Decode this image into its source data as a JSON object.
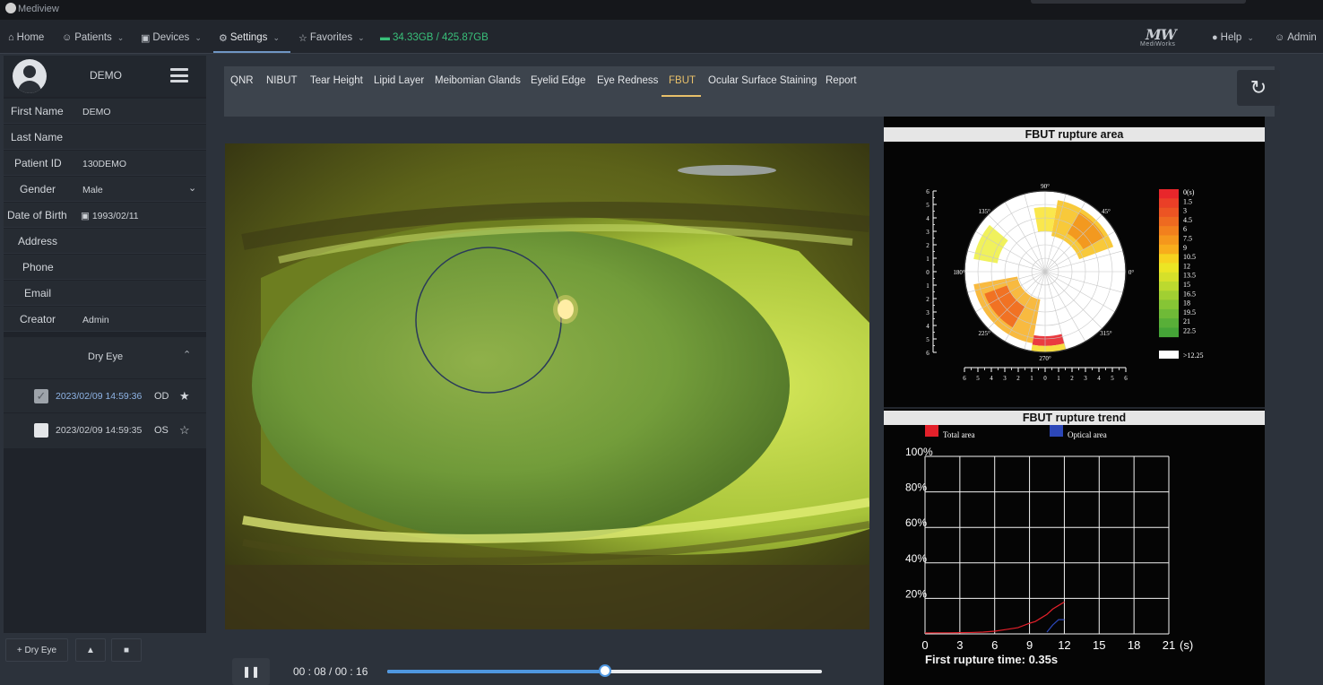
{
  "window": {
    "title": "Mediview"
  },
  "topnav": {
    "home": "Home",
    "patients": "Patients",
    "devices": "Devices",
    "settings": "Settings",
    "favorites": "Favorites",
    "storage": "34.33GB / 425.87GB",
    "brand_mark": "MW",
    "brand_name": "MediWorks",
    "help": "Help",
    "user": "Admin"
  },
  "profile": {
    "name": "DEMO"
  },
  "fields": [
    {
      "label": "First Name",
      "value": "DEMO"
    },
    {
      "label": "Last Name",
      "value": ""
    },
    {
      "label": "Patient ID",
      "value": "130DEMO"
    },
    {
      "label": "Gender",
      "value": "Male"
    },
    {
      "label": "Date of Birth",
      "value": "1993/02/11"
    },
    {
      "label": "Address",
      "value": ""
    },
    {
      "label": "Phone",
      "value": ""
    },
    {
      "label": "Email",
      "value": ""
    },
    {
      "label": "Creator",
      "value": "Admin"
    }
  ],
  "exam_group": {
    "title": "Dry Eye",
    "exams": [
      {
        "timestamp": "2023/02/09 14:59:36",
        "eye": "OD",
        "checked": true,
        "starred": true
      },
      {
        "timestamp": "2023/02/09 14:59:35",
        "eye": "OS",
        "checked": false,
        "starred": false
      }
    ]
  },
  "sidebar_buttons": {
    "add": "+ Dry Eye"
  },
  "tabs": [
    "QNR",
    "NIBUT",
    "Tear Height",
    "Lipid Layer",
    "Meibomian Glands",
    "Eyelid Edge",
    "Eye Redness",
    "FBUT",
    "Ocular Surface Staining",
    "Report"
  ],
  "active_tab": "FBUT",
  "player": {
    "time": "00 : 08 / 00 : 16",
    "progress": 0.5
  },
  "area_chart": {
    "title": "FBUT rupture area",
    "angle_labels": [
      "90°",
      "45°",
      "0°",
      "315°",
      "270°",
      "225°",
      "180°",
      "135°"
    ],
    "radial_ticks": [
      "6",
      "5",
      "4",
      "3",
      "2",
      "1",
      "0",
      "1",
      "2",
      "3",
      "4",
      "5",
      "6"
    ],
    "legend": [
      {
        "label": "0(s)",
        "color": "#e8262b"
      },
      {
        "label": "1.5",
        "color": "#ea3f27"
      },
      {
        "label": "3",
        "color": "#ec5423"
      },
      {
        "label": "4.5",
        "color": "#ee6a20"
      },
      {
        "label": "6",
        "color": "#f2801d"
      },
      {
        "label": "7.5",
        "color": "#f5971c"
      },
      {
        "label": "9",
        "color": "#f8ad1c"
      },
      {
        "label": "10.5",
        "color": "#f7d21f"
      },
      {
        "label": "12",
        "color": "#ece524"
      },
      {
        "label": "13.5",
        "color": "#d6e02a"
      },
      {
        "label": "15",
        "color": "#bcd92f"
      },
      {
        "label": "16.5",
        "color": "#a1cf32"
      },
      {
        "label": "18",
        "color": "#86c535"
      },
      {
        "label": "19.5",
        "color": "#6fba37"
      },
      {
        "label": "21",
        "color": "#58af38"
      },
      {
        "label": "22.5",
        "color": "#45a437"
      }
    ],
    "legend_over": ">12.25"
  },
  "chart_data": {
    "type": "line",
    "title": "FBUT rupture trend",
    "xlabel": "(s)",
    "x_ticks": [
      0,
      3,
      6,
      9,
      12,
      15,
      18,
      21
    ],
    "y_ticks": [
      "100%",
      "80%",
      "60%",
      "40%",
      "20%"
    ],
    "xlim": [
      0,
      21
    ],
    "ylim": [
      0,
      100
    ],
    "series": [
      {
        "name": "Total area",
        "color": "#e3202a",
        "x": [
          0,
          1,
          2,
          3,
          4,
          5,
          6,
          7,
          8,
          9,
          9.5,
          10,
          10.5,
          11,
          11.5,
          12
        ],
        "y": [
          0.5,
          0.6,
          0.6,
          0.7,
          0.8,
          1.0,
          1.5,
          2.5,
          3.5,
          6,
          7,
          9,
          11,
          14,
          16,
          18
        ]
      },
      {
        "name": "Optical area",
        "color": "#2c47b8",
        "x": [
          10.5,
          11,
          11.5,
          12
        ],
        "y": [
          1,
          5,
          8,
          8
        ]
      }
    ],
    "first_rupture": "First rupture time:  0.35s"
  }
}
